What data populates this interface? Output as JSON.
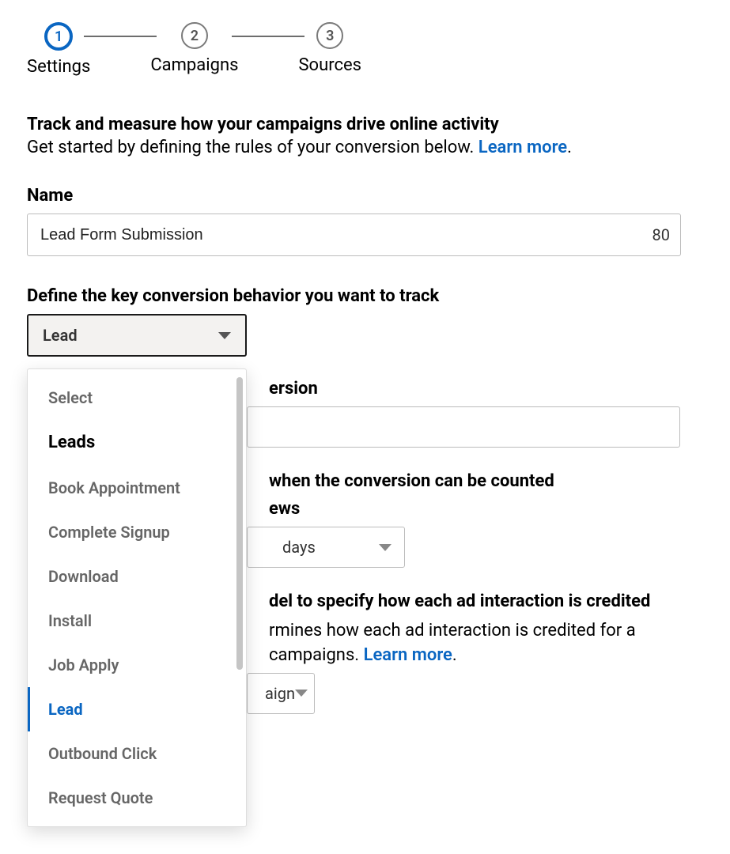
{
  "stepper": [
    {
      "num": "1",
      "label": "Settings",
      "active": true
    },
    {
      "num": "2",
      "label": "Campaigns",
      "active": false
    },
    {
      "num": "3",
      "label": "Sources",
      "active": false
    }
  ],
  "intro": {
    "title": "Track and measure how your campaigns drive online activity",
    "sub_prefix": "Get started by defining the rules of your conversion below. ",
    "learn_more": "Learn more",
    "period": "."
  },
  "name_section": {
    "label": "Name",
    "value": "Lead Form Submission",
    "counter": "80"
  },
  "behavior_section": {
    "label": "Define the key conversion behavior you want to track",
    "selected": "Lead"
  },
  "dropdown_items": [
    {
      "label": "Select",
      "kind": "muted"
    },
    {
      "label": "Leads",
      "kind": "category"
    },
    {
      "label": "Book Appointment",
      "kind": "item"
    },
    {
      "label": "Complete Signup",
      "kind": "item"
    },
    {
      "label": "Download",
      "kind": "item"
    },
    {
      "label": "Install",
      "kind": "item"
    },
    {
      "label": "Job Apply",
      "kind": "item"
    },
    {
      "label": "Lead",
      "kind": "selected"
    },
    {
      "label": "Outbound Click",
      "kind": "item"
    },
    {
      "label": "Request Quote",
      "kind": "item"
    }
  ],
  "bg": {
    "value_title_partial": "ersion",
    "timeframe_title_partial": "when the conversion can be counted",
    "timeframe_sub_partial": "ews",
    "timeframe_select_partial": "days",
    "attribution_title_partial": "del to specify how each ad interaction is credited",
    "attribution_text_1": "rmines how each ad interaction is credited for a",
    "attribution_text_2a": "campaigns. ",
    "attribution_learn_more": "Learn more",
    "attribution_period": ".",
    "attribution_select_partial": "aign"
  }
}
